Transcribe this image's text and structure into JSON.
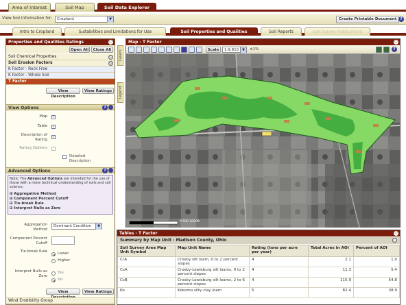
{
  "top_tabs": [
    "Area of Interest",
    "Soil Map",
    "Soil Data Explorer"
  ],
  "info_row": {
    "label": "View Soil Information for:",
    "selected": "Cropland",
    "print_button": "Create Printable Document"
  },
  "sub_tabs": [
    "Intro to Cropland",
    "Suitabilities and Limitations for Use",
    "Soil Properties and Qualities",
    "Soil Reports",
    "Soil Survey Publications"
  ],
  "left_panel": {
    "title": "Properties and Qualities Ratings",
    "open_all": "Open All",
    "close_all": "Close All",
    "groups": [
      "Soil Chemical Properties",
      "Soil Erosion Factors"
    ],
    "erosion_items": [
      "K Factor - Rock Free",
      "K Factor - Whole Soil",
      "T Factor"
    ],
    "view_description": "View Description",
    "view_ratings": "View Ratings",
    "view_options": {
      "title": "View Options",
      "map": "Map",
      "table": "Table",
      "description": "Description of Rating",
      "rating_options": "Rating Options",
      "detailed": "Detailed Description"
    },
    "advanced": {
      "title": "Advanced Options",
      "note_prefix": "Note: The",
      "note_bold": "Advanced Options",
      "note_rest": "are intended for the use of those with a more technical understanding of soils and soil science.",
      "items": [
        "Aggregation Method",
        "Component Percent Cutoff",
        "Tie-break Rule",
        "Interpret Nulls as Zero"
      ],
      "aggregation_label": "Aggregation Method",
      "aggregation_value": "Dominant Condition",
      "cutoff_label": "Component Percent Cutoff",
      "tiebreak_label": "Tie-break Rule",
      "tiebreak_options": [
        "Lower",
        "Higher"
      ],
      "nulls_label": "Interpret Nulls as Zero",
      "nulls_options": [
        "Yes",
        "No"
      ]
    },
    "bottom_group": "Wind Erodibility Group"
  },
  "map": {
    "title": "Map - T Factor",
    "scale_label": "Scale",
    "scale_value": "1:9,810",
    "percent": "±1%",
    "side_tabs": [
      "Layers",
      "Legend"
    ],
    "scalebar_text": "0 500 1000ft"
  },
  "table": {
    "title": "Tables - T Factor",
    "summary": "Summary by Map Unit - Madison County, Ohio",
    "columns": [
      "Soil Survey Area Map Unit Symbol",
      "Map Unit Name",
      "Rating (tons per acre per year)",
      "Total Acres in AOI",
      "Percent of AOI"
    ],
    "rows": [
      [
        "CrA",
        "Crosby silt loam, 0 to 2 percent slopes",
        "4",
        "2.1",
        "1.0"
      ],
      [
        "CsA",
        "Crosby-Lewisburg silt loams, 0 to 2 percent slopes",
        "4",
        "11.3",
        "5.4"
      ],
      [
        "CsB",
        "Crosby-Lewisburg silt loams, 2 to 6 percent slopes",
        "4",
        "115.9",
        "54.8"
      ],
      [
        "Ko",
        "Kokomo silty clay loam",
        "5",
        "82.4",
        "38.9"
      ]
    ]
  },
  "colors": {
    "accent": "#7a1c0c",
    "polygon_light": "#8fe06a",
    "polygon_dark": "#2c9a2c"
  }
}
